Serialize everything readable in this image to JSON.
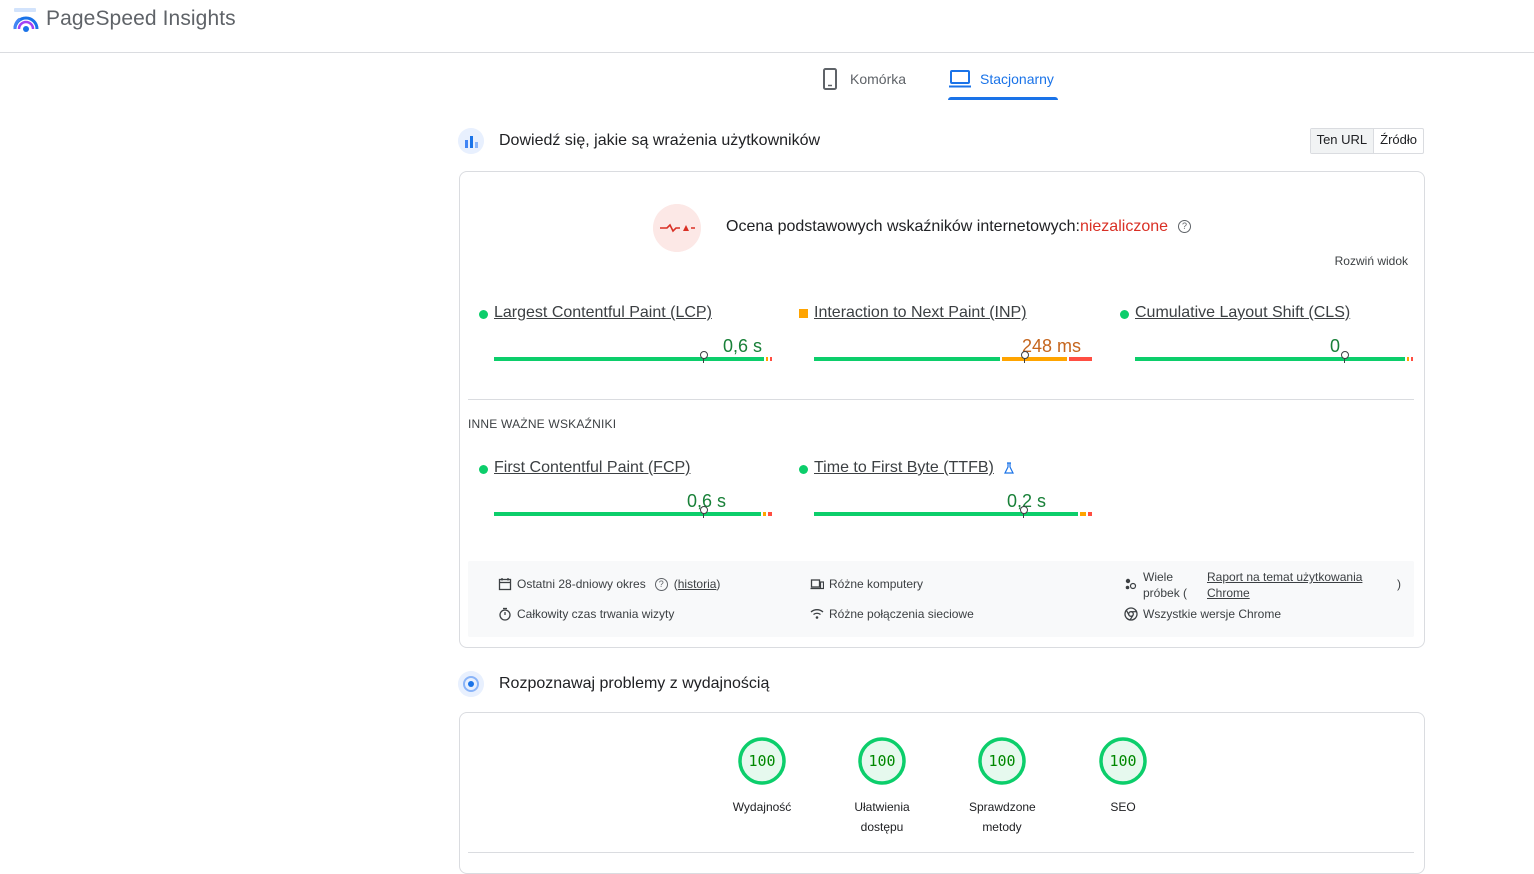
{
  "app": {
    "title": "PageSpeed Insights"
  },
  "tabs": [
    {
      "label": "Komórka",
      "icon": "smartphone-icon",
      "active": false
    },
    {
      "label": "Stacjonarny",
      "icon": "laptop-icon",
      "active": true
    }
  ],
  "field_section": {
    "title": "Dowiedź się, jakie są wrażenia użytkowników",
    "toggle": {
      "url_label": "Ten URL",
      "origin_label": "Źródło",
      "selected": "Ten URL"
    },
    "assessment": {
      "label": "Ocena podstawowych wskaźników internetowych:",
      "status": "niezaliczone",
      "status_color": "#d93025",
      "help": "?",
      "expand_label": "Rozwiń widok"
    },
    "core_metrics": [
      {
        "name": "Largest Contentful Paint (LCP)",
        "value": "0,6 s",
        "rating": "good",
        "marker_fraction": 0.745,
        "distribution": {
          "good": 0.97,
          "needs_improvement": 0.015,
          "poor": 0.015
        }
      },
      {
        "name": "Interaction to Next Paint (INP)",
        "value": "248 ms",
        "rating": "average",
        "marker_fraction": 0.75,
        "distribution": {
          "good": 0.67,
          "needs_improvement": 0.24,
          "poor": 0.09
        }
      },
      {
        "name": "Cumulative Layout Shift (CLS)",
        "value": "0",
        "rating": "good",
        "marker_fraction": 0.745,
        "distribution": {
          "good": 0.97,
          "needs_improvement": 0.015,
          "poor": 0.015
        }
      }
    ],
    "other_label": "INNE WAŻNE WSKAŹNIKI",
    "other_metrics": [
      {
        "name": "First Contentful Paint (FCP)",
        "value": "0,6 s",
        "rating": "good",
        "marker_fraction": 0.745,
        "distribution": {
          "good": 0.96,
          "needs_improvement": 0.02,
          "poor": 0.02
        }
      },
      {
        "name": "Time to First Byte (TTFB)",
        "value": "0,2 s",
        "rating": "good",
        "marker_fraction": 0.745,
        "experimental_icon": "flask-icon",
        "distribution": {
          "good": 0.95,
          "needs_improvement": 0.03,
          "poor": 0.02
        }
      }
    ],
    "info": {
      "period": "Ostatni 28-dniowy okres",
      "history_link": "historia",
      "devices": "Różne komputery",
      "samples_prefix": "Wiele próbek (",
      "samples_link": "Raport na temat użytkowania Chrome",
      "samples_suffix": ")",
      "duration": "Całkowity czas trwania wizyty",
      "network": "Różne połączenia sieciowe",
      "chrome": "Wszystkie wersje Chrome"
    }
  },
  "perf_section": {
    "title": "Rozpoznawaj problemy z wydajnością",
    "gauges": [
      {
        "score": "100",
        "label": "Wydajność"
      },
      {
        "score": "100",
        "label": "Ułatwienia dostępu"
      },
      {
        "score": "100",
        "label": "Sprawdzone metody"
      },
      {
        "score": "100",
        "label": "SEO"
      }
    ],
    "score_color": "#0cce6b"
  },
  "colors": {
    "good": "#0cce6b",
    "average": "#ffa400",
    "poor": "#ff4e42",
    "accent": "#1a73e8"
  }
}
